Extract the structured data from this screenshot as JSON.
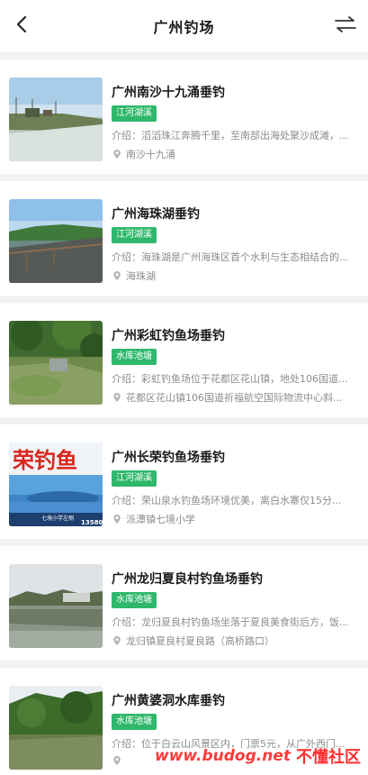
{
  "header": {
    "title": "广州钓场",
    "back_icon": "chevron-left-icon",
    "switch_icon": "swap-arrows-icon"
  },
  "spots": [
    {
      "title": "广州南沙十九涌垂钓",
      "tag": "江河湖溪",
      "desc": "介绍：滔滔珠江奔腾千里，至南部出海处聚沙成滩，...",
      "location": "南沙十九涌"
    },
    {
      "title": "广州海珠湖垂钓",
      "tag": "江河湖溪",
      "desc": "介绍：海珠湖是广州海珠区首个水利与生态相结合的...",
      "location": "海珠湖"
    },
    {
      "title": "广州彩虹钓鱼场垂钓",
      "tag": "水库池塘",
      "desc": "介绍：彩虹钓鱼场位于花都区花山镇，地处106国道...",
      "location": "花都区花山镇106国道祈福航空国际物流中心斜..."
    },
    {
      "title": "广州长荣钓鱼场垂钓",
      "tag": "江河湖溪",
      "desc": "介绍：荣山泉水钓鱼场环境优美，离白水寨仅15分...",
      "location": "派潭镇七境小学",
      "thumb_text": "荣钓鱼",
      "thumb_caption": "七境小学左侧",
      "thumb_phone": "13580"
    },
    {
      "title": "广州龙归夏良村钓鱼场垂钓",
      "tag": "水库池塘",
      "desc": "介绍：龙归夏良村钓鱼场坐落于夏良美食街后方，饭...",
      "location": "龙归镇夏良村夏良路（高桥路口）"
    },
    {
      "title": "广州黄婆洞水库垂钓",
      "tag": "水库池塘",
      "desc": "介绍：位于白云山风景区内，门票5元，从广外西门...",
      "location": ""
    }
  ],
  "watermark": {
    "url": "www.budog.net",
    "site": "不懂社区"
  },
  "colors": {
    "tag_bg": "#2fb86b",
    "watermark": "#ff3a3a"
  }
}
